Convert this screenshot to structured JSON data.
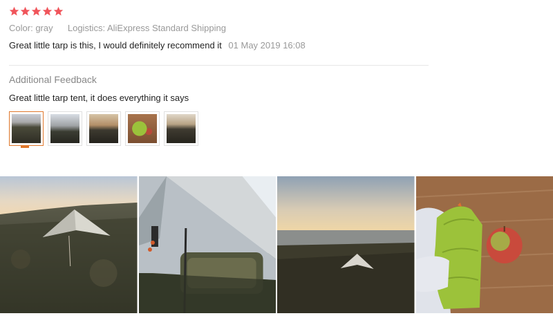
{
  "review": {
    "rating": 5,
    "star_color": "#f0555b",
    "color_label": "Color:",
    "color_value": "gray",
    "logistics_label": "Logistics:",
    "logistics_value": "AliExpress Standard Shipping",
    "text": "Great little tarp is this, I would definitely recommend it",
    "date": "01 May 2019 16:08"
  },
  "additional": {
    "title": "Additional Feedback",
    "text": "Great little tarp tent, it does everything it says"
  },
  "thumbnails": {
    "count": 5,
    "active_index": 0,
    "accent": "#e0782c"
  },
  "gallery": {
    "count": 4
  }
}
